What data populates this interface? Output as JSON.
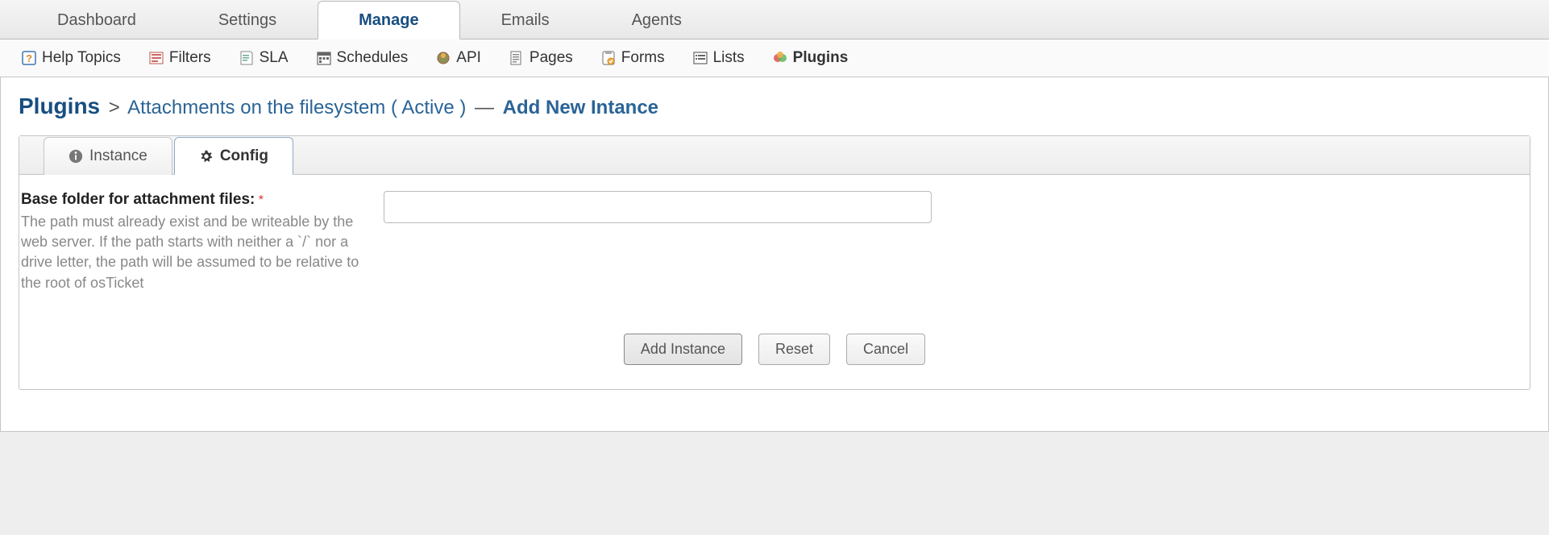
{
  "main_tabs": {
    "dashboard": "Dashboard",
    "settings": "Settings",
    "manage": "Manage",
    "emails": "Emails",
    "agents": "Agents"
  },
  "sub_nav": {
    "help_topics": "Help Topics",
    "filters": "Filters",
    "sla": "SLA",
    "schedules": "Schedules",
    "api": "API",
    "pages": "Pages",
    "forms": "Forms",
    "lists": "Lists",
    "plugins": "Plugins"
  },
  "breadcrumb": {
    "root": "Plugins",
    "sep1": ">",
    "path": "Attachments on the filesystem ( Active )",
    "sep2": "—",
    "action": "Add New Intance"
  },
  "inner_tabs": {
    "instance": "Instance",
    "config": "Config"
  },
  "form": {
    "base_folder_label": "Base folder for attachment files:",
    "base_folder_help": "The path must already exist and be writeable by the web server. If the path starts with neither a `/` nor a drive letter, the path will be assumed to be relative to the root of osTicket",
    "base_folder_value": ""
  },
  "buttons": {
    "add_instance": "Add Instance",
    "reset": "Reset",
    "cancel": "Cancel"
  }
}
